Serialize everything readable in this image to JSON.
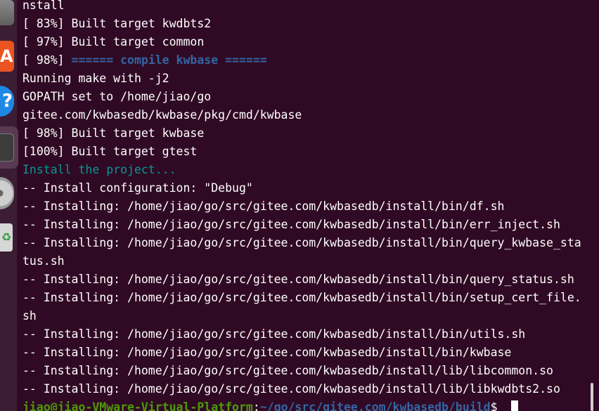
{
  "terminal": {
    "lines": [
      {
        "text": "nstall"
      },
      {
        "text": "[ 83%] Built target kwdbts2"
      },
      {
        "text": "[ 97%] Built target common"
      },
      {
        "prefix": "[ 98%] ",
        "highlight": "====== compile kwbase ======"
      },
      {
        "text": "Running make with -j2"
      },
      {
        "text": "GOPATH set to /home/jiao/go"
      },
      {
        "text": "gitee.com/kwbasedb/kwbase/pkg/cmd/kwbase"
      },
      {
        "text": "[ 98%] Built target kwbase"
      },
      {
        "text": "[100%] Built target gtest"
      },
      {
        "text": "Install the project..."
      },
      {
        "text": "-- Install configuration: \"Debug\""
      },
      {
        "text": "-- Installing: /home/jiao/go/src/gitee.com/kwbasedb/install/bin/df.sh"
      },
      {
        "text": "-- Installing: /home/jiao/go/src/gitee.com/kwbasedb/install/bin/err_inject.sh"
      },
      {
        "text": "-- Installing: /home/jiao/go/src/gitee.com/kwbasedb/install/bin/query_kwbase_sta"
      },
      {
        "text": "tus.sh"
      },
      {
        "text": "-- Installing: /home/jiao/go/src/gitee.com/kwbasedb/install/bin/query_status.sh"
      },
      {
        "text": "-- Installing: /home/jiao/go/src/gitee.com/kwbasedb/install/bin/setup_cert_file."
      },
      {
        "text": "sh"
      },
      {
        "text": "-- Installing: /home/jiao/go/src/gitee.com/kwbasedb/install/bin/utils.sh"
      },
      {
        "text": "-- Installing: /home/jiao/go/src/gitee.com/kwbasedb/install/bin/kwbase"
      },
      {
        "text": "-- Installing: /home/jiao/go/src/gitee.com/kwbasedb/install/lib/libcommon.so"
      },
      {
        "text": "-- Installing: /home/jiao/go/src/gitee.com/kwbasedb/install/lib/libkwdbts2.so"
      }
    ],
    "prompt": {
      "user_host": "jiao@jiao-VMware-Virtual-Platform",
      "separator": ":",
      "path": "~/go/src/gitee.com/kwbasedb/build",
      "symbol": "$ "
    }
  },
  "dock": {
    "app_store_glyph": "A",
    "help_glyph": "?",
    "trash_glyph": "♻"
  },
  "colors": {
    "background": "#300a24",
    "text": "#ffffff",
    "highlight_blue": "#3465a4",
    "cyan": "#06989a",
    "prompt_green": "#4e9a06"
  }
}
